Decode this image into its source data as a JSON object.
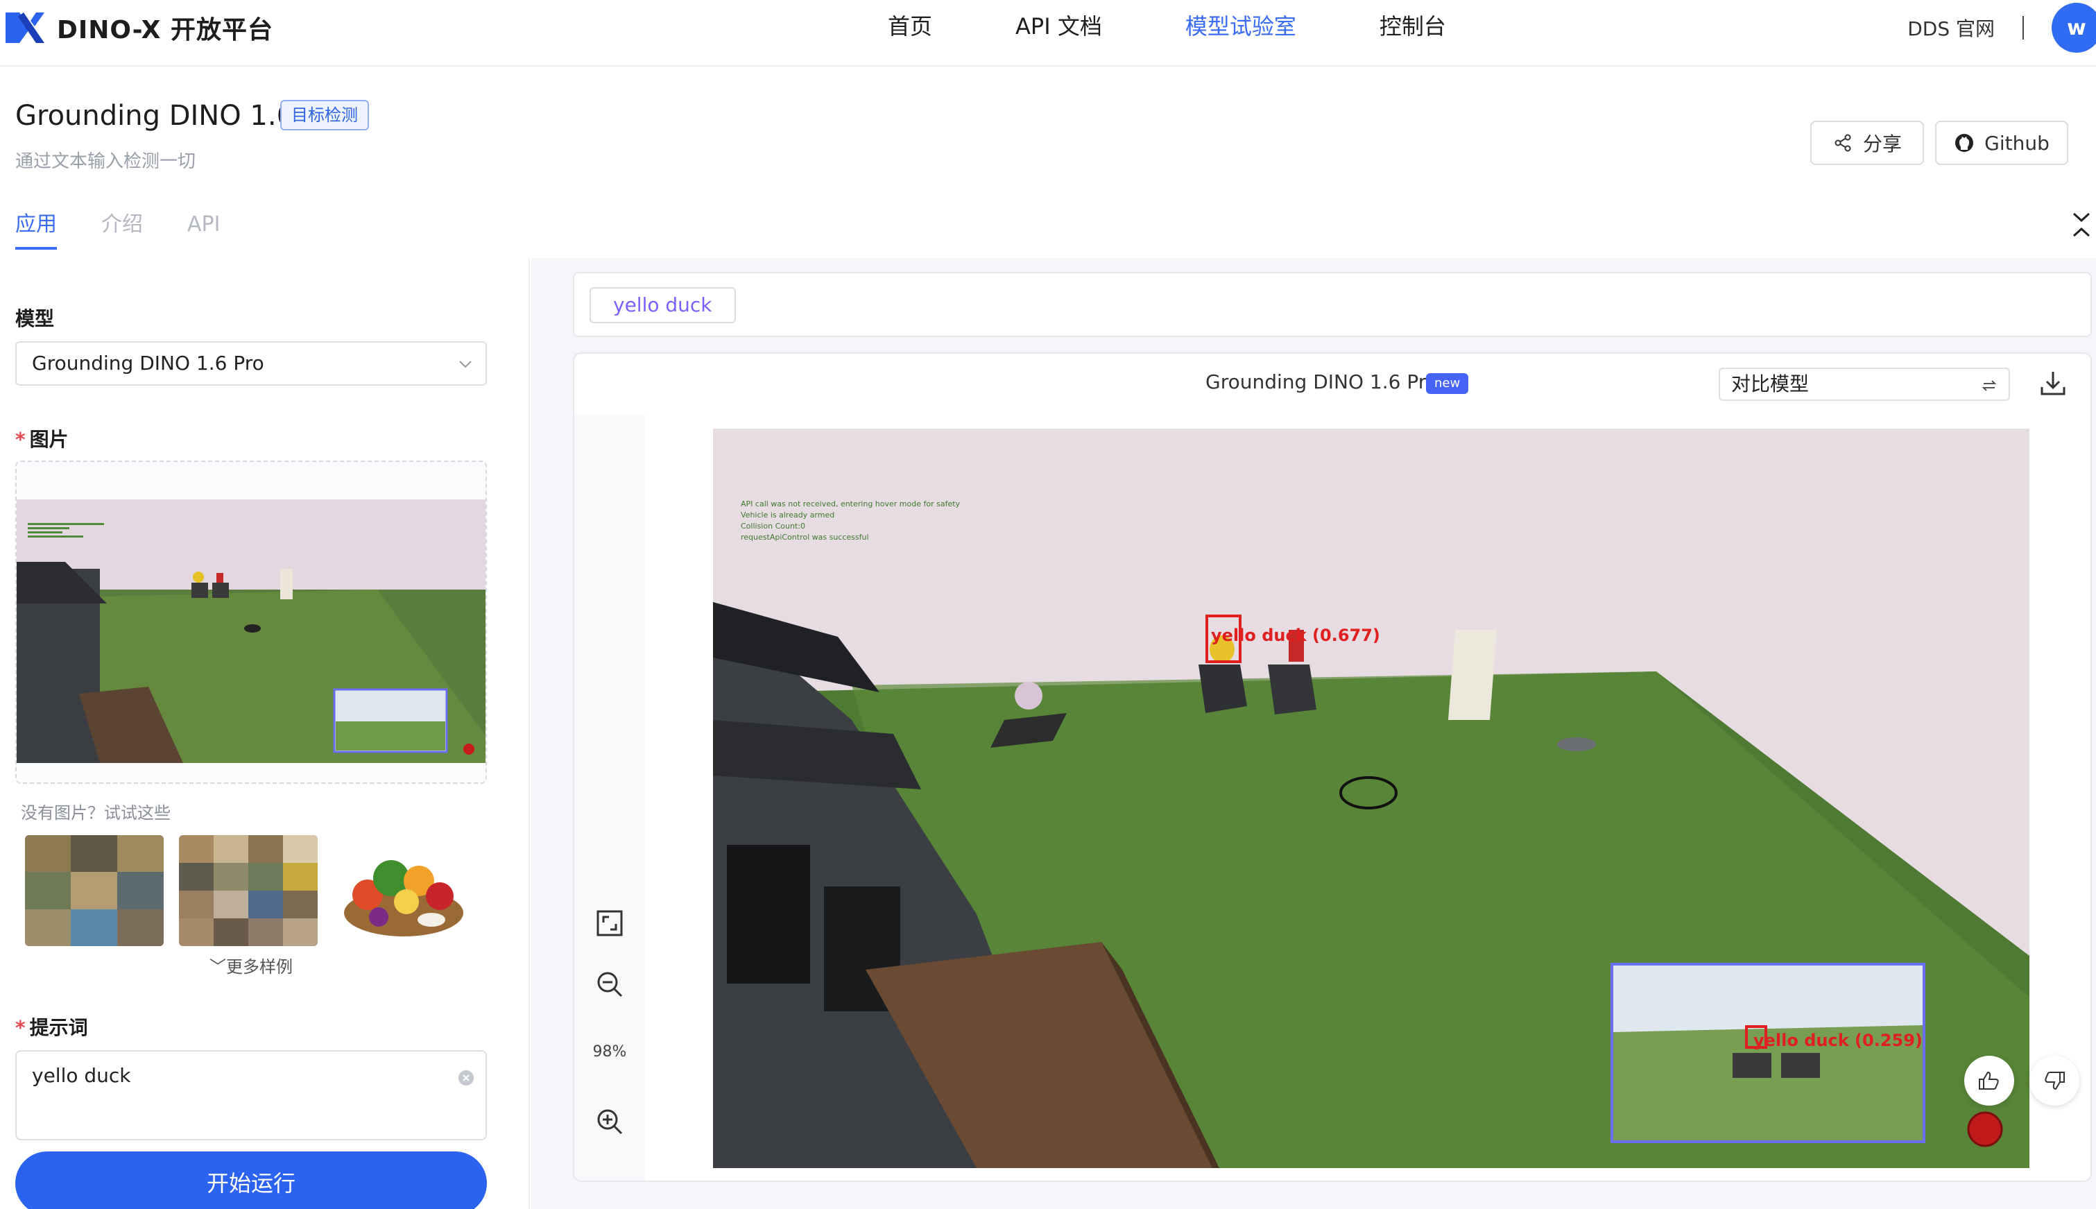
{
  "nav": {
    "brand": "DINO-X 开放平台",
    "links": [
      "首页",
      "API 文档",
      "模型试验室",
      "控制台"
    ],
    "active_link": "模型试验室",
    "dds_link": "DDS 官网",
    "avatar_initial": "w"
  },
  "header": {
    "title": "Grounding DINO 1.6",
    "badge": "目标检测",
    "subtitle": "通过文本输入检测一切",
    "share_label": "分享",
    "github_label": "Github"
  },
  "tabs": [
    {
      "label": "应用",
      "active": true
    },
    {
      "label": "介绍",
      "active": false
    },
    {
      "label": "API",
      "active": false
    }
  ],
  "left": {
    "model_label": "模型",
    "model_value": "Grounding DINO 1.6 Pro",
    "image_label": "图片",
    "try_hint": "没有图片？试试这些",
    "more_samples": "更多样例",
    "prompt_label": "提示词",
    "prompt_value": "yello duck",
    "run_label": "开始运行"
  },
  "result": {
    "tag": "yello duck",
    "model_name": "Grounding DINO 1.6 Pro",
    "new_badge": "new",
    "compare_placeholder": "对比模型",
    "zoom": "98%",
    "scene_text": [
      "API call was not received, entering hover mode for safety",
      "Vehicle is already armed",
      "Collision Count:0",
      "requestApiControl was successful"
    ],
    "detections": [
      {
        "label": "yello duck (0.677)"
      },
      {
        "label": "yello duck (0.259)"
      }
    ]
  },
  "colors": {
    "accent": "#3a6cf6",
    "run_button": "#2b62f0",
    "detection_box": "#e02020",
    "tag_text": "#7b61ff"
  }
}
